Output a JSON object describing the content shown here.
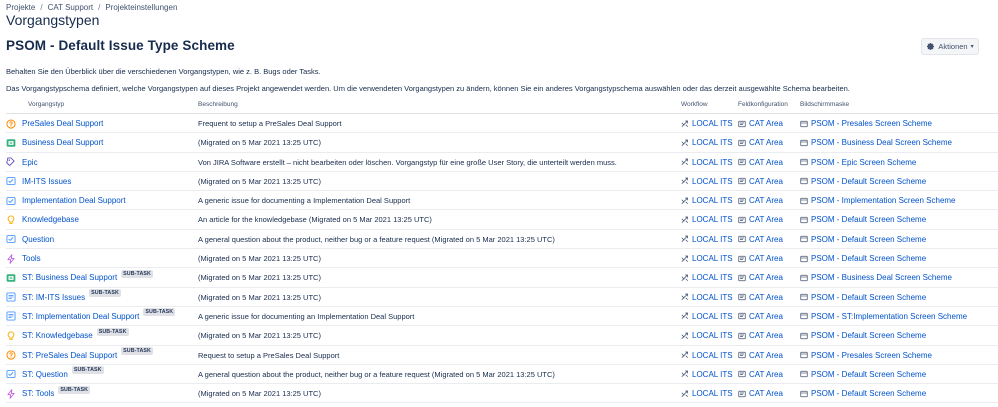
{
  "breadcrumb": [
    "Projekte",
    "CAT Support",
    "Projekteinstellungen"
  ],
  "page_title": "Vorgangstypen",
  "scheme_title": "PSOM - Default Issue Type Scheme",
  "actions_label": "Aktionen",
  "description_1": "Behalten Sie den Überblick über die verschiedenen Vorgangstypen, wie z. B. Bugs oder Tasks.",
  "description_2": "Das Vorgangstypschema definiert, welche Vorgangstypen auf dieses Projekt angewendet werden. Um die verwendeten Vorgangstypen zu ändern, können Sie ein anderes Vorgangstypschema auswählen oder das derzeit ausgewählte Schema bearbeiten.",
  "columns": {
    "type": "Vorgangstyp",
    "description": "Beschreibung",
    "workflow": "Workflow",
    "field_config": "Feldkonfiguration",
    "screen_scheme": "Bildschirmmaske"
  },
  "subtask_badge": "SUB-TASK",
  "rows": [
    {
      "name": "PreSales Deal Support",
      "icon": "question-icon",
      "subtask": false,
      "description": "Frequent to setup a PreSales Deal Support",
      "workflow": "LOCAL ITS",
      "field_config": "CAT Area",
      "screen_scheme": "PSOM - Presales Screen Scheme"
    },
    {
      "name": "Business Deal Support",
      "icon": "business-icon",
      "subtask": false,
      "description": "(Migrated on 5 Mar 2021 13:25 UTC)",
      "workflow": "LOCAL ITS",
      "field_config": "CAT Area",
      "screen_scheme": "PSOM - Business Deal Screen Scheme"
    },
    {
      "name": "Epic",
      "icon": "epic-icon",
      "subtask": false,
      "description": "Von JIRA Software erstellt – nicht bearbeiten oder löschen. Vorgangstyp für eine große User Story, die unterteilt werden muss.",
      "workflow": "LOCAL ITS",
      "field_config": "CAT Area",
      "screen_scheme": "PSOM - Epic Screen Scheme"
    },
    {
      "name": "IM-ITS Issues",
      "icon": "task-icon",
      "subtask": false,
      "description": "(Migrated on 5 Mar 2021 13:25 UTC)",
      "workflow": "LOCAL ITS",
      "field_config": "CAT Area",
      "screen_scheme": "PSOM - Default Screen Scheme"
    },
    {
      "name": "Implementation Deal Support",
      "icon": "task-icon",
      "subtask": false,
      "description": "A generic issue for documenting a Implementation Deal Support",
      "workflow": "LOCAL ITS",
      "field_config": "CAT Area",
      "screen_scheme": "PSOM - Implementation Screen Scheme"
    },
    {
      "name": "Knowledgebase",
      "icon": "lightbulb-icon",
      "subtask": false,
      "description": "An article for the knowledgebase (Migrated on 5 Mar 2021 13:25 UTC)",
      "workflow": "LOCAL ITS",
      "field_config": "CAT Area",
      "screen_scheme": "PSOM - Default Screen Scheme"
    },
    {
      "name": "Question",
      "icon": "task-icon",
      "subtask": false,
      "description": "A general question about the product, neither bug or a feature request (Migrated on 5 Mar 2021 13:25 UTC)",
      "workflow": "LOCAL ITS",
      "field_config": "CAT Area",
      "screen_scheme": "PSOM - Default Screen Scheme"
    },
    {
      "name": "Tools",
      "icon": "lightning-icon",
      "subtask": false,
      "description": "(Migrated on 5 Mar 2021 13:25 UTC)",
      "workflow": "LOCAL ITS",
      "field_config": "CAT Area",
      "screen_scheme": "PSOM - Default Screen Scheme"
    },
    {
      "name": "ST: Business Deal Support",
      "icon": "business-icon",
      "subtask": true,
      "description": "(Migrated on 5 Mar 2021 13:25 UTC)",
      "workflow": "LOCAL ITS",
      "field_config": "CAT Area",
      "screen_scheme": "PSOM - Business Deal Screen Scheme"
    },
    {
      "name": "ST: IM-ITS Issues",
      "icon": "document-icon",
      "subtask": true,
      "description": "(Migrated on 5 Mar 2021 13:25 UTC)",
      "workflow": "LOCAL ITS",
      "field_config": "CAT Area",
      "screen_scheme": "PSOM - Default Screen Scheme"
    },
    {
      "name": "ST: Implementation Deal Support",
      "icon": "document-icon",
      "subtask": true,
      "description": "A generic issue for documenting an Implementation Deal Support",
      "workflow": "LOCAL ITS",
      "field_config": "CAT Area",
      "screen_scheme": "PSOM - ST:Implementation Screen Scheme"
    },
    {
      "name": "ST: Knowledgebase",
      "icon": "lightbulb-icon",
      "subtask": true,
      "description": "(Migrated on 5 Mar 2021 13:25 UTC)",
      "workflow": "LOCAL ITS",
      "field_config": "CAT Area",
      "screen_scheme": "PSOM - Default Screen Scheme"
    },
    {
      "name": "ST: PreSales Deal Support",
      "icon": "question-icon",
      "subtask": true,
      "description": "Request to setup a PreSales Deal Support",
      "workflow": "LOCAL ITS",
      "field_config": "CAT Area",
      "screen_scheme": "PSOM - Presales Screen Scheme"
    },
    {
      "name": "ST: Question",
      "icon": "task-icon",
      "subtask": true,
      "description": "A general question about the product, neither bug or a feature request (Migrated on 5 Mar 2021 13:25 UTC)",
      "workflow": "LOCAL ITS",
      "field_config": "CAT Area",
      "screen_scheme": "PSOM - Default Screen Scheme"
    },
    {
      "name": "ST: Tools",
      "icon": "lightning-icon",
      "subtask": true,
      "description": "(Migrated on 5 Mar 2021 13:25 UTC)",
      "workflow": "LOCAL ITS",
      "field_config": "CAT Area",
      "screen_scheme": "PSOM - Default Screen Scheme"
    }
  ],
  "colors": {
    "link": "#0052cc",
    "text": "#172b4d",
    "muted": "#42526e",
    "question_icon": "#ff8b00",
    "business_icon": "#36b37e",
    "epic_icon": "#6554c0",
    "task_icon": "#4c9aff",
    "lightbulb_icon": "#ffab00",
    "lightning_icon": "#c05ee0"
  }
}
